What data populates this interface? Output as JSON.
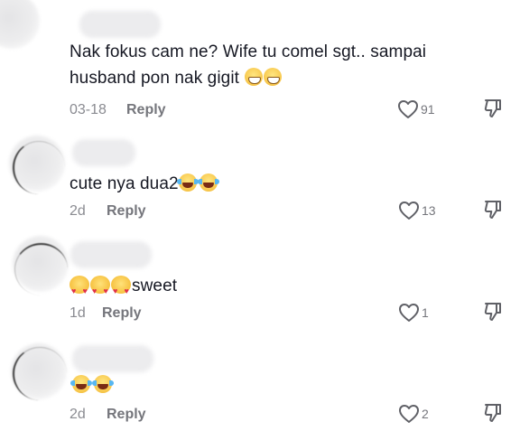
{
  "comments": [
    {
      "text_line1": "Nak fokus cam ne? Wife tu comel sgt.. sampai",
      "text_line2": "husband pon nak gigit",
      "emojis": [
        "grinning-face",
        "grinning-face"
      ],
      "date": "03-18",
      "reply_label": "Reply",
      "likes": "91"
    },
    {
      "text": "cute nya dua2",
      "emojis": [
        "face-with-tears-of-joy",
        "face-with-tears-of-joy"
      ],
      "date": "2d",
      "reply_label": "Reply",
      "likes": "13"
    },
    {
      "text": "sweet",
      "emojis": [
        "smiling-face-with-hearts",
        "smiling-face-with-hearts",
        "smiling-face-with-hearts"
      ],
      "date": "1d",
      "reply_label": "Reply",
      "likes": "1"
    },
    {
      "text": "",
      "emojis": [
        "face-with-tears-of-joy",
        "face-with-tears-of-joy"
      ],
      "date": "2d",
      "reply_label": "Reply",
      "likes": "2"
    }
  ],
  "icons": {
    "like": "heart-outline-icon",
    "dislike": "thumbs-down-icon"
  },
  "colors": {
    "text": "#161823",
    "meta": "#8a8b91",
    "reply": "#75767c",
    "icon_stroke": "#5f6066"
  }
}
